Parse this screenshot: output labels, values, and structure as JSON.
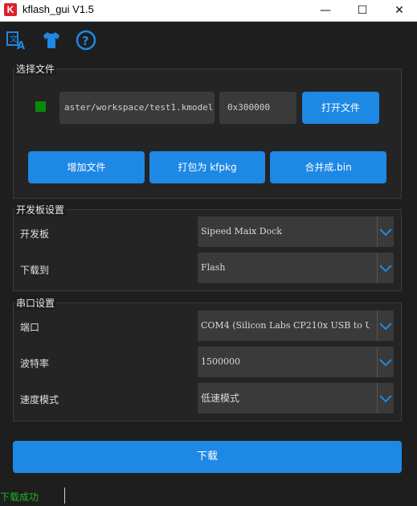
{
  "window": {
    "title": "kflash_gui V1.5",
    "app_icon_letter": "K",
    "minimize": "—",
    "maximize": "☐",
    "close": "✕"
  },
  "toolbar": {
    "icons": [
      "language-icon",
      "shirt-icon",
      "help-icon"
    ],
    "icon_color": "#1e88e5"
  },
  "file_section": {
    "title": "选择文件",
    "status_color": "#0a8a0a",
    "path_value": "aster/workspace/test1.kmodel",
    "address_value": "0x300000",
    "open_button": "打开文件",
    "add_file_button": "增加文件",
    "pack_button": "打包为 kfpkg",
    "merge_button": "合并成.bin"
  },
  "board_section": {
    "title": "开发板设置",
    "board_label": "开发板",
    "board_value": "Sipeed Maix Dock",
    "download_to_label": "下载到",
    "download_to_value": "Flash"
  },
  "serial_section": {
    "title": "串口设置",
    "port_label": "端口",
    "port_value": "COM4 (Silicon Labs CP210x USB to U",
    "baud_label": "波特率",
    "baud_value": "1500000",
    "speed_label": "速度模式",
    "speed_value": "低速模式"
  },
  "download_button": "下载",
  "status": {
    "text": "下载成功",
    "color": "#1fb51f"
  },
  "accent_color": "#1e88e5"
}
